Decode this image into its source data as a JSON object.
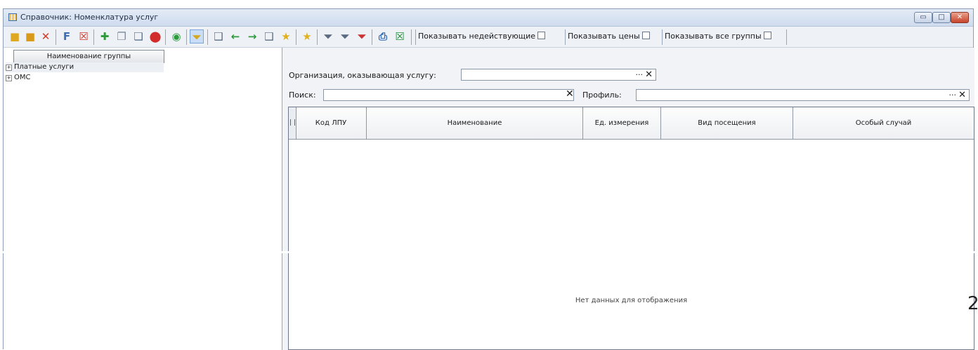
{
  "window": {
    "title": "Справочник: Номенклатура услуг",
    "minimize_glyph": "▭",
    "maximize_glyph": "□",
    "close_glyph": "✕"
  },
  "toolbar": {
    "icons": [
      {
        "name": "add-group-icon",
        "glyph": "■",
        "color": "#e0a722"
      },
      {
        "name": "edit-group-icon",
        "glyph": "■",
        "color": "#d99a1c"
      },
      {
        "name": "delete-group-icon",
        "glyph": "✕",
        "color": "#d23b2a"
      },
      {
        "name": "sort-icon",
        "glyph": "F",
        "color": "#3c6fb4"
      },
      {
        "name": "clear-sort-icon",
        "glyph": "☒",
        "color": "#c9382a"
      },
      {
        "name": "add-record-icon",
        "glyph": "✚",
        "color": "#2c9a3a"
      },
      {
        "name": "copy-record-icon",
        "glyph": "❐",
        "color": "#7b8899"
      },
      {
        "name": "edit-record-icon",
        "glyph": "❏",
        "color": "#5a6f8a"
      },
      {
        "name": "delete-record-icon",
        "glyph": "⬤",
        "color": "#d12b2b"
      },
      {
        "name": "refresh-icon",
        "glyph": "◉",
        "color": "#2a9c3e"
      },
      {
        "name": "filter-active-icon",
        "glyph": "⏷",
        "color": "#d4a81c"
      },
      {
        "name": "document-icon",
        "glyph": "❑",
        "color": "#5b6b80"
      },
      {
        "name": "arrow-left-icon",
        "glyph": "←",
        "color": "#2d9a3c"
      },
      {
        "name": "arrow-right-icon",
        "glyph": "→",
        "color": "#2d9a3c"
      },
      {
        "name": "export-icon",
        "glyph": "❑",
        "color": "#5b6b80"
      },
      {
        "name": "star-add-icon",
        "glyph": "★",
        "color": "#e0b11c"
      },
      {
        "name": "favorite-icon",
        "glyph": "★",
        "color": "#e0b11c"
      },
      {
        "name": "filter-icon",
        "glyph": "⏷",
        "color": "#5a6a80"
      },
      {
        "name": "filter-edit-icon",
        "glyph": "⏷",
        "color": "#5a6a80"
      },
      {
        "name": "filter-clear-icon",
        "glyph": "⏷",
        "color": "#c33"
      },
      {
        "name": "print-icon",
        "glyph": "⎙",
        "color": "#2e66b5"
      },
      {
        "name": "excel-icon",
        "glyph": "☒",
        "color": "#1f8a3a"
      }
    ],
    "show_inactive_label": "Показывать недействующие",
    "show_prices_label": "Показывать цены",
    "show_all_groups_label": "Показывать все группы"
  },
  "left_panel": {
    "header": "Наименование группы",
    "items": [
      {
        "label": "Платные услуги"
      },
      {
        "label": "ОМС"
      }
    ],
    "expand_glyph": "+"
  },
  "filters": {
    "org_label": "Организация, оказывающая услугу:",
    "org_value": "",
    "search_label": "Поиск:",
    "search_value": "",
    "profile_label": "Профиль:",
    "profile_value": "",
    "dots": "···",
    "clear": "✕"
  },
  "grid": {
    "columns": [
      "Код ЛПУ",
      "Наименование",
      "Ед. измерения",
      "Вид посещения",
      "Особый случай"
    ],
    "empty_text": "Нет данных для отображения"
  },
  "page_number": "2",
  "colors": {
    "accent": "#3d6fb0",
    "title_bar": "#cfdcee",
    "selected_tool": "#c9ddf6"
  }
}
